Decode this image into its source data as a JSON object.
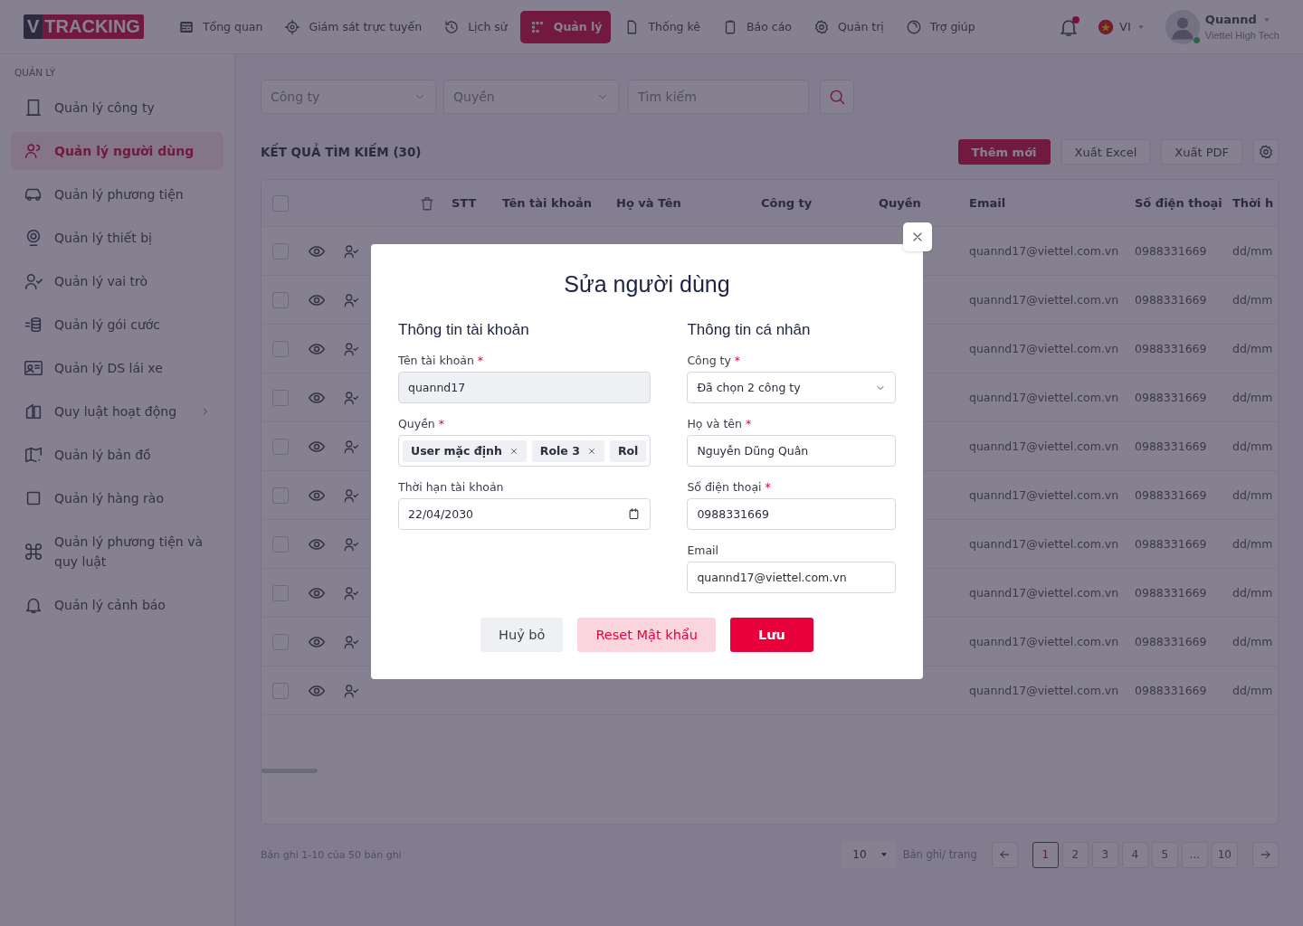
{
  "header": {
    "logo": {
      "letter": "V",
      "word": "TRACKING"
    },
    "nav": [
      {
        "label": "Tổng quan",
        "selected": false
      },
      {
        "label": "Giám sát trực tuyến",
        "selected": false
      },
      {
        "label": "Lịch sử",
        "selected": false
      },
      {
        "label": "Quản lý",
        "selected": true
      },
      {
        "label": "Thống kê",
        "selected": false
      },
      {
        "label": "Báo cáo",
        "selected": false
      },
      {
        "label": "Quản trị",
        "selected": false
      },
      {
        "label": "Trợ giúp",
        "selected": false
      }
    ],
    "notifications": {
      "unread": true
    },
    "language": "VI",
    "user": {
      "name": "Quannd",
      "company": "Viettel High Tech",
      "online": true
    }
  },
  "sidebar": {
    "section": "QUẢN LÝ",
    "items": [
      {
        "label": "Quản lý công ty",
        "selected": false,
        "expandable": false
      },
      {
        "label": "Quản lý người dùng",
        "selected": true,
        "expandable": false
      },
      {
        "label": "Quản lý phương tiện",
        "selected": false,
        "expandable": false
      },
      {
        "label": "Quản lý thiết bị",
        "selected": false,
        "expandable": false
      },
      {
        "label": "Quản lý vai trò",
        "selected": false,
        "expandable": false
      },
      {
        "label": "Quản lý gói cước",
        "selected": false,
        "expandable": false
      },
      {
        "label": "Quản lý DS lái xe",
        "selected": false,
        "expandable": false
      },
      {
        "label": "Quy luật hoạt động",
        "selected": false,
        "expandable": true
      },
      {
        "label": "Quản lý bản đồ",
        "selected": false,
        "expandable": false
      },
      {
        "label": "Quản lý hàng rào",
        "selected": false,
        "expandable": false
      },
      {
        "label": "Quản lý phương tiện và quy luật",
        "selected": false,
        "expandable": false
      },
      {
        "label": "Quản lý cảnh báo",
        "selected": false,
        "expandable": false
      }
    ]
  },
  "filters": {
    "company": {
      "placeholder": "Công ty"
    },
    "role": {
      "placeholder": "Quyền"
    },
    "search": {
      "placeholder": "Tìm kiếm"
    }
  },
  "results": {
    "title": "KẾT QUẢ TÌM KIẾM (30)",
    "buttons": [
      {
        "label": "Thêm mới",
        "kind": "primary"
      },
      {
        "label": "Xuất Excel",
        "kind": "outline"
      },
      {
        "label": "Xuất PDF",
        "kind": "outline"
      }
    ]
  },
  "table": {
    "all_checked": false,
    "columns": [
      "STT",
      "Tên tài khoản",
      "Họ và Tên",
      "Công ty",
      "Quyền",
      "Email",
      "Số điện thoại",
      "Thời h"
    ],
    "rows": [
      {
        "checked": false,
        "email": "quannd17@viettel.com.vn",
        "phone": "0988331669",
        "expiry": "dd/mm"
      },
      {
        "checked": false,
        "email": "quannd17@viettel.com.vn",
        "phone": "0988331669",
        "expiry": "dd/mm"
      },
      {
        "checked": false,
        "email": "quannd17@viettel.com.vn",
        "phone": "0988331669",
        "expiry": "dd/mm"
      },
      {
        "checked": false,
        "email": "quannd17@viettel.com.vn",
        "phone": "0988331669",
        "expiry": "dd/mm"
      },
      {
        "checked": false,
        "email": "quannd17@viettel.com.vn",
        "phone": "0988331669",
        "expiry": "dd/mm"
      },
      {
        "checked": false,
        "email": "quannd17@viettel.com.vn",
        "phone": "0988331669",
        "expiry": "dd/mm"
      },
      {
        "checked": false,
        "email": "quannd17@viettel.com.vn",
        "phone": "0988331669",
        "expiry": "dd/mm"
      },
      {
        "checked": false,
        "email": "quannd17@viettel.com.vn",
        "phone": "0988331669",
        "expiry": "dd/mm"
      },
      {
        "checked": false,
        "email": "quannd17@viettel.com.vn",
        "phone": "0988331669",
        "expiry": "dd/mm"
      },
      {
        "checked": false,
        "email": "quannd17@viettel.com.vn",
        "phone": "0988331669",
        "expiry": "dd/mm"
      }
    ]
  },
  "pagination": {
    "summary": "Bản ghi 1-10 của 50 bản ghi",
    "page_size": "10",
    "page_size_label": "Bản ghi/ trang",
    "pages": [
      {
        "label": "1",
        "selected": true
      },
      {
        "label": "2",
        "selected": false
      },
      {
        "label": "3",
        "selected": false
      },
      {
        "label": "4",
        "selected": false
      },
      {
        "label": "5",
        "selected": false
      },
      {
        "label": "...",
        "selected": false
      },
      {
        "label": "10",
        "selected": false
      }
    ]
  },
  "dialog": {
    "title": "Sửa người dùng",
    "required_mark": "*",
    "columns": [
      {
        "heading": "Thông tin tài khoản",
        "fields": [
          {
            "label": "Tên tài khoản",
            "required": true,
            "kind": "text",
            "value": "quannd17",
            "disabled": true
          },
          {
            "label": "Quyền",
            "required": true,
            "kind": "tags",
            "tags": [
              "User mặc định",
              "Role 3",
              "Rol"
            ]
          },
          {
            "label": "Thời hạn tài khoản",
            "required": false,
            "kind": "date",
            "value": "22/04/2030"
          }
        ]
      },
      {
        "heading": "Thông tin cá nhân",
        "fields": [
          {
            "label": "Công ty",
            "required": true,
            "kind": "select",
            "value": "Đã chọn 2 công ty"
          },
          {
            "label": "Họ và tên",
            "required": true,
            "kind": "text",
            "value": "Nguyễn Dũng Quân",
            "disabled": false
          },
          {
            "label": "Số điện thoại",
            "required": true,
            "kind": "text",
            "value": "0988331669",
            "disabled": false
          },
          {
            "label": "Email",
            "required": false,
            "kind": "text",
            "value": "quannd17@viettel.com.vn",
            "disabled": false
          }
        ]
      }
    ],
    "buttons": [
      {
        "label": "Huỷ bỏ",
        "kind": "secondary"
      },
      {
        "label": "Reset Mật khẩu",
        "kind": "soft"
      },
      {
        "label": "Lưu",
        "kind": "primary"
      }
    ]
  }
}
